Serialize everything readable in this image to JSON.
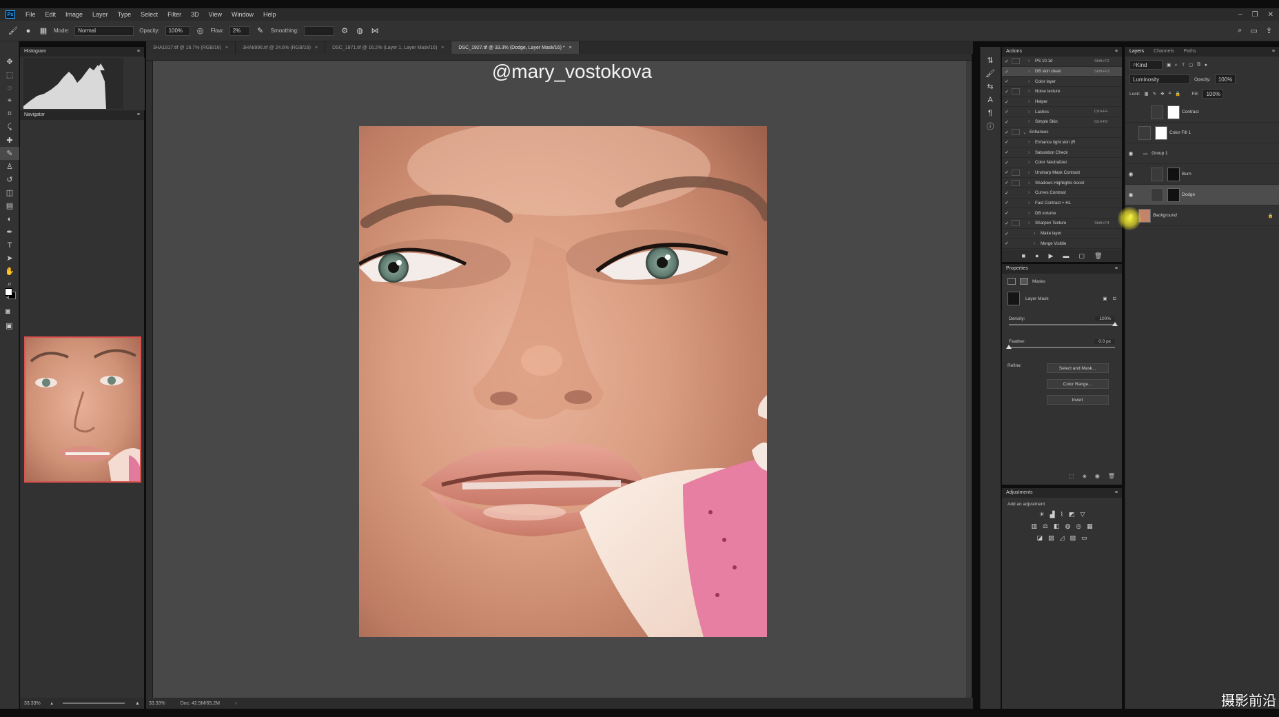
{
  "app": {
    "menu": [
      "File",
      "Edit",
      "Image",
      "Layer",
      "Type",
      "Select",
      "Filter",
      "3D",
      "View",
      "Window",
      "Help"
    ],
    "logo": "Ps"
  },
  "options": {
    "mode_label": "Mode:",
    "mode_value": "Normal",
    "opacity_label": "Opacity:",
    "opacity_value": "100%",
    "flow_label": "Flow:",
    "flow_value": "2%",
    "smoothing_label": "Smoothing:"
  },
  "tabs": [
    {
      "label": "3HA1917.tif @ 16.7% (RGB/16)"
    },
    {
      "label": "3HA8996.tif @ 24.6% (RGB/16)"
    },
    {
      "label": "DSC_1871.tif @ 16.2% (Layer 1, Layer Mask/16)"
    },
    {
      "label": "DSC_1927.tif @ 33.3% (Dodge, Layer Mask/16) *"
    }
  ],
  "tab_close": "×",
  "left_panel": {
    "histogram_title": "Histogram",
    "navigator_title": "Navigator",
    "zoom": "33.33%"
  },
  "canvas": {
    "watermark": "@mary_vostokova"
  },
  "status": {
    "zoom": "33.33%",
    "doc": "Doc: 42.5M/65.2M"
  },
  "actions": {
    "title": "Actions",
    "items": [
      {
        "name": "PS 10.1d",
        "shortcut": "Shift+F2",
        "dialog": true,
        "level": 1
      },
      {
        "name": "DB skin clean",
        "shortcut": "Shift+F3",
        "dialog": false,
        "level": 1,
        "selected": true
      },
      {
        "name": "Color layer",
        "shortcut": "",
        "dialog": false,
        "level": 1
      },
      {
        "name": "Noise texture",
        "shortcut": "",
        "dialog": true,
        "level": 1
      },
      {
        "name": "Helper",
        "shortcut": "",
        "dialog": false,
        "level": 1
      },
      {
        "name": "Lashes",
        "shortcut": "Ctrl+F4",
        "dialog": false,
        "level": 1
      },
      {
        "name": "Simple Skin",
        "shortcut": "Ctrl+F2",
        "dialog": false,
        "level": 1
      },
      {
        "name": "Enhances",
        "shortcut": "",
        "dialog": true,
        "level": 0
      },
      {
        "name": "Enhance light skin (R",
        "shortcut": "",
        "dialog": false,
        "level": 1
      },
      {
        "name": "Saturation Check",
        "shortcut": "",
        "dialog": false,
        "level": 1
      },
      {
        "name": "Color Neutralizer",
        "shortcut": "",
        "dialog": false,
        "level": 1
      },
      {
        "name": "Unsharp Mask Contrast",
        "shortcut": "",
        "dialog": true,
        "level": 1
      },
      {
        "name": "Shadows Highlights boost",
        "shortcut": "",
        "dialog": true,
        "level": 1
      },
      {
        "name": "Curves Contrast",
        "shortcut": "",
        "dialog": false,
        "level": 1
      },
      {
        "name": "Fast Contrast + HL",
        "shortcut": "",
        "dialog": false,
        "level": 1
      },
      {
        "name": "DB volume",
        "shortcut": "",
        "dialog": false,
        "level": 1
      },
      {
        "name": "Sharpen Texture",
        "shortcut": "Shift+F4",
        "dialog": true,
        "level": 1
      },
      {
        "name": "Make layer",
        "shortcut": "",
        "dialog": false,
        "level": 2
      },
      {
        "name": "Merge Visible",
        "shortcut": "",
        "dialog": false,
        "level": 2
      }
    ]
  },
  "properties": {
    "title": "Properties",
    "masks_label": "Masks",
    "layer_mask_label": "Layer Mask",
    "density_label": "Density:",
    "density_value": "100%",
    "density_level": 1.0,
    "feather_label": "Feather:",
    "feather_value": "0.0 px",
    "feather_level": 0.0,
    "refine_label": "Refine:",
    "buttons": [
      "Select and Mask...",
      "Color Range...",
      "Invert"
    ]
  },
  "adjustments": {
    "title": "Adjustments",
    "subtitle": "Add an adjustment"
  },
  "layers": {
    "tabs": [
      "Layers",
      "Channels",
      "Paths"
    ],
    "kind": "Kind",
    "blend": "Luminosity",
    "opacity_label": "Opacity:",
    "opacity_value": "100%",
    "lock_label": "Lock:",
    "fill_label": "Fill:",
    "fill_value": "100%",
    "items": [
      {
        "name": "Contrast",
        "visible": false,
        "indent": true,
        "thumb": "#ffffff",
        "selected": false
      },
      {
        "name": "Color Fill 1",
        "visible": false,
        "indent": false,
        "thumb": "#ffffff",
        "selected": false
      },
      {
        "name": "Group 1",
        "visible": true,
        "indent": false,
        "thumb": "",
        "selected": false,
        "group": true
      },
      {
        "name": "Burn",
        "visible": true,
        "indent": true,
        "thumb": "#111111",
        "selected": false
      },
      {
        "name": "Dodge",
        "visible": true,
        "indent": true,
        "thumb": "#111111",
        "selected": true
      },
      {
        "name": "Background",
        "visible": true,
        "indent": false,
        "thumb": "#c4846a",
        "selected": false,
        "locked": true
      }
    ]
  },
  "site_watermark": "摄影前沿 sheyingzyz.com"
}
